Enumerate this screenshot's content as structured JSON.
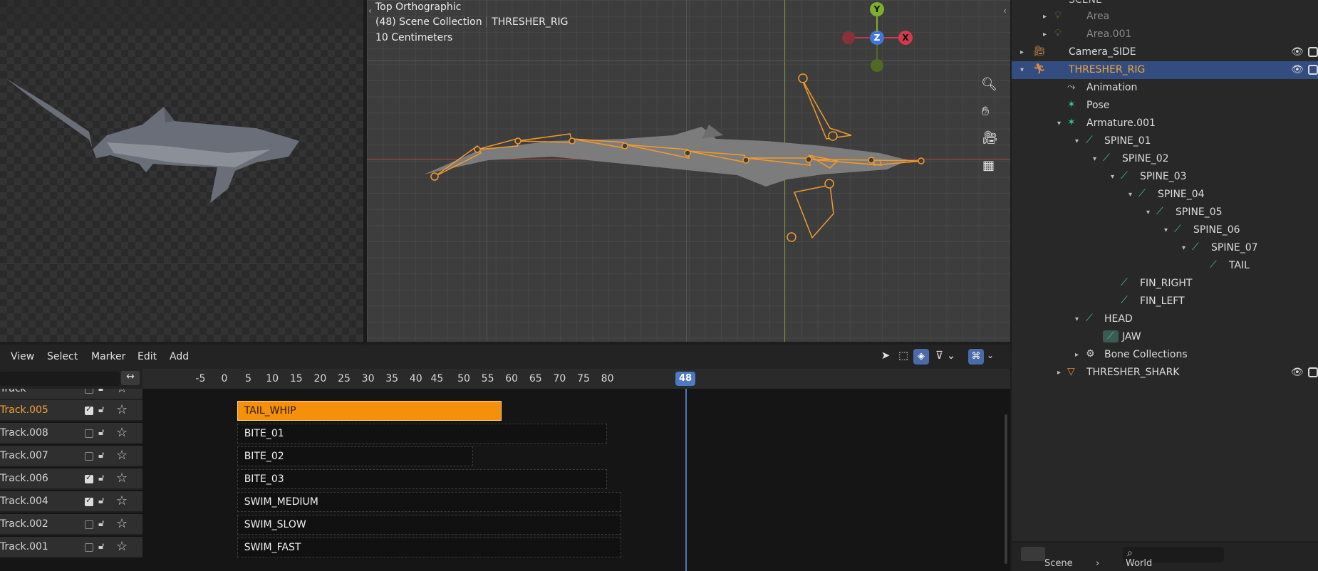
{
  "viewport": {
    "view_name": "Top Orthographic",
    "collection_info": "(48) Scene Collection | THRESHER_RIG",
    "scale": "10 Centimeters",
    "gizmo": {
      "y": "Y",
      "z": "Z",
      "x": "X"
    }
  },
  "outliner": {
    "header_partial": "SCENE",
    "rows": [
      {
        "label": "Area",
        "icon": "light-icon",
        "dim": true
      },
      {
        "label": "Area.001",
        "icon": "light-icon",
        "dim": true
      },
      {
        "label": "Camera_SIDE",
        "icon": "camera-icon"
      },
      {
        "label": "THRESHER_RIG",
        "icon": "armature-icon",
        "selected": true
      },
      {
        "label": "Animation",
        "icon": "animation-icon"
      },
      {
        "label": "Pose",
        "icon": "pose-icon"
      },
      {
        "label": "Armature.001",
        "icon": "armature-data-icon"
      },
      {
        "label": "SPINE_01",
        "icon": "bone-icon"
      },
      {
        "label": "SPINE_02",
        "icon": "bone-icon"
      },
      {
        "label": "SPINE_03",
        "icon": "bone-icon"
      },
      {
        "label": "SPINE_04",
        "icon": "bone-icon"
      },
      {
        "label": "SPINE_05",
        "icon": "bone-icon"
      },
      {
        "label": "SPINE_06",
        "icon": "bone-icon"
      },
      {
        "label": "SPINE_07",
        "icon": "bone-icon"
      },
      {
        "label": "TAIL",
        "icon": "bone-icon"
      },
      {
        "label": "FIN_RIGHT",
        "icon": "bone-icon"
      },
      {
        "label": "FIN_LEFT",
        "icon": "bone-icon"
      },
      {
        "label": "HEAD",
        "icon": "bone-icon"
      },
      {
        "label": "JAW",
        "icon": "bone-icon"
      },
      {
        "label": "Bone Collections",
        "icon": "bone-collection-icon"
      },
      {
        "label": "THRESHER_SHARK",
        "icon": "mesh-icon"
      }
    ],
    "footer": {
      "scene": "Scene",
      "world": "World"
    }
  },
  "nla": {
    "menus": [
      "View",
      "Select",
      "Marker",
      "Edit",
      "Add"
    ],
    "ruler_ticks": [
      "-5",
      "0",
      "5",
      "10",
      "15",
      "20",
      "25",
      "30",
      "35",
      "40",
      "45",
      "50",
      "55",
      "60",
      "65",
      "70",
      "75",
      "80"
    ],
    "current_frame": "48",
    "tracks": [
      {
        "name": "Track",
        "checked": false
      },
      {
        "name": "Track.005",
        "checked": true,
        "active": true
      },
      {
        "name": "Track.008",
        "checked": false
      },
      {
        "name": "Track.007",
        "checked": false
      },
      {
        "name": "Track.006",
        "checked": true
      },
      {
        "name": "Track.004",
        "checked": true
      },
      {
        "name": "Track.002",
        "checked": false
      },
      {
        "name": "Track.001",
        "checked": false
      }
    ],
    "strips": [
      {
        "label": "TAIL_WHIP",
        "start": 1,
        "end": 56,
        "active": true
      },
      {
        "label": "BITE_01",
        "start": 1,
        "end": 78
      },
      {
        "label": "BITE_02",
        "start": 1,
        "end": 50
      },
      {
        "label": "BITE_03",
        "start": 1,
        "end": 78
      },
      {
        "label": "SWIM_MEDIUM",
        "start": 1,
        "end": 81
      },
      {
        "label": "SWIM_SLOW",
        "start": 1,
        "end": 81
      },
      {
        "label": "SWIM_FAST",
        "start": 1,
        "end": 81
      }
    ]
  },
  "colors": {
    "selection": "#334d80",
    "active_strip": "#f4900a",
    "bone_orange": "#f39a2c",
    "bone_icon": "#36c7a5",
    "playhead": "#4f79c0"
  }
}
